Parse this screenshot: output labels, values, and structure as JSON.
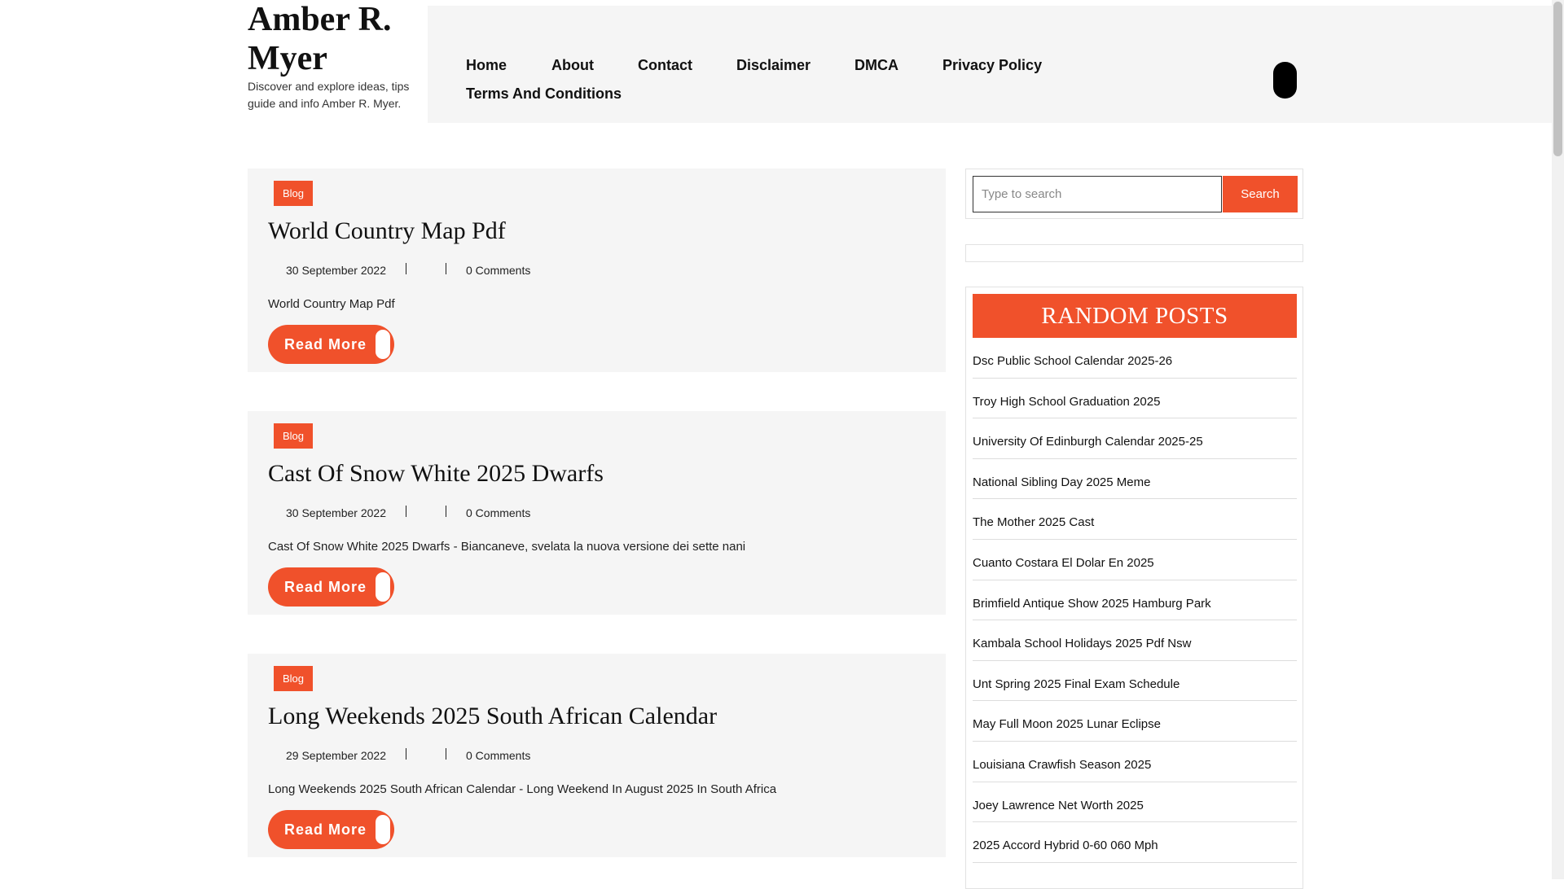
{
  "site": {
    "title": "Amber R. Myer",
    "description": "Discover and explore ideas, tips guide and info Amber R. Myer."
  },
  "nav": {
    "items": [
      "Home",
      "About",
      "Contact",
      "Disclaimer",
      "DMCA",
      "Privacy Policy",
      "Terms And Conditions"
    ]
  },
  "posts": [
    {
      "category": "Blog",
      "title": "World Country Map Pdf",
      "date": "30 September 2022",
      "comments": "0 Comments",
      "excerpt": "World Country Map Pdf",
      "read_more": "Read More"
    },
    {
      "category": "Blog",
      "title": "Cast Of Snow White 2025 Dwarfs",
      "date": "30 September 2022",
      "comments": "0 Comments",
      "excerpt": "Cast Of Snow White 2025 Dwarfs - Biancaneve, svelata la nuova versione dei sette nani",
      "read_more": "Read More"
    },
    {
      "category": "Blog",
      "title": "Long Weekends 2025 South African Calendar",
      "date": "29 September 2022",
      "comments": "0 Comments",
      "excerpt": "Long Weekends 2025 South African Calendar - Long Weekend In August 2025 In South Africa",
      "read_more": "Read More"
    }
  ],
  "sidebar": {
    "search": {
      "placeholder": "Type to search",
      "button": "Search"
    },
    "random_posts": {
      "title": "RANDOM POSTS",
      "items": [
        "Dsc Public School Calendar 2025-26",
        "Troy High School Graduation 2025",
        "University Of Edinburgh Calendar 2025-25",
        "National Sibling Day 2025 Meme",
        "The Mother 2025 Cast",
        "Cuanto Costara El Dolar En 2025",
        "Brimfield Antique Show 2025 Hamburg Park",
        "Kambala School Holidays 2025 Pdf Nsw",
        "Unt Spring 2025 Final Exam Schedule",
        "May Full Moon 2025 Lunar Eclipse",
        "Louisiana Crawfish Season 2025",
        "Joey Lawrence Net Worth 2025",
        "2025 Accord Hybrid 0-60 060 Mph"
      ]
    }
  },
  "colors": {
    "accent": "#f0512b",
    "panel_bg": "#f5f5f5"
  }
}
